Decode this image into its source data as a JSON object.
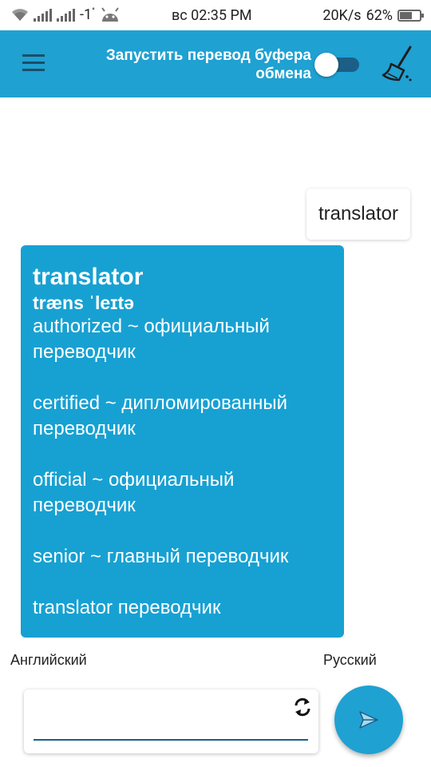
{
  "status_bar": {
    "sim_indicator": "-1",
    "sim_superscript": "°",
    "time": "вс 02:35 PM",
    "network_speed": "20K/s",
    "battery_percent": "62%",
    "battery_level": 0.62
  },
  "app_bar": {
    "menu_icon": "hamburger-menu-icon",
    "clipboard_translate_label": "Запустить перевод буфера обмена",
    "clipboard_toggle_on": false,
    "clear_icon": "broom-icon",
    "accent_color": "#1fa1d2"
  },
  "chat": {
    "user_message": "translator",
    "result": {
      "word": "translator",
      "transcription": "træns ˈleɪtə",
      "lines": "authorized ~ официальный переводчик\n\ncertified ~ дипломированный переводчик\n\nofficial ~ официальный переводчик\n\nsenior ~ главный переводчик\n\ntranslator переводчик"
    }
  },
  "languages": {
    "from": "Английский",
    "to": "Русский"
  },
  "input": {
    "value": "",
    "placeholder": "",
    "swap_icon": "swap-languages-icon"
  },
  "send_icon": "send-icon"
}
